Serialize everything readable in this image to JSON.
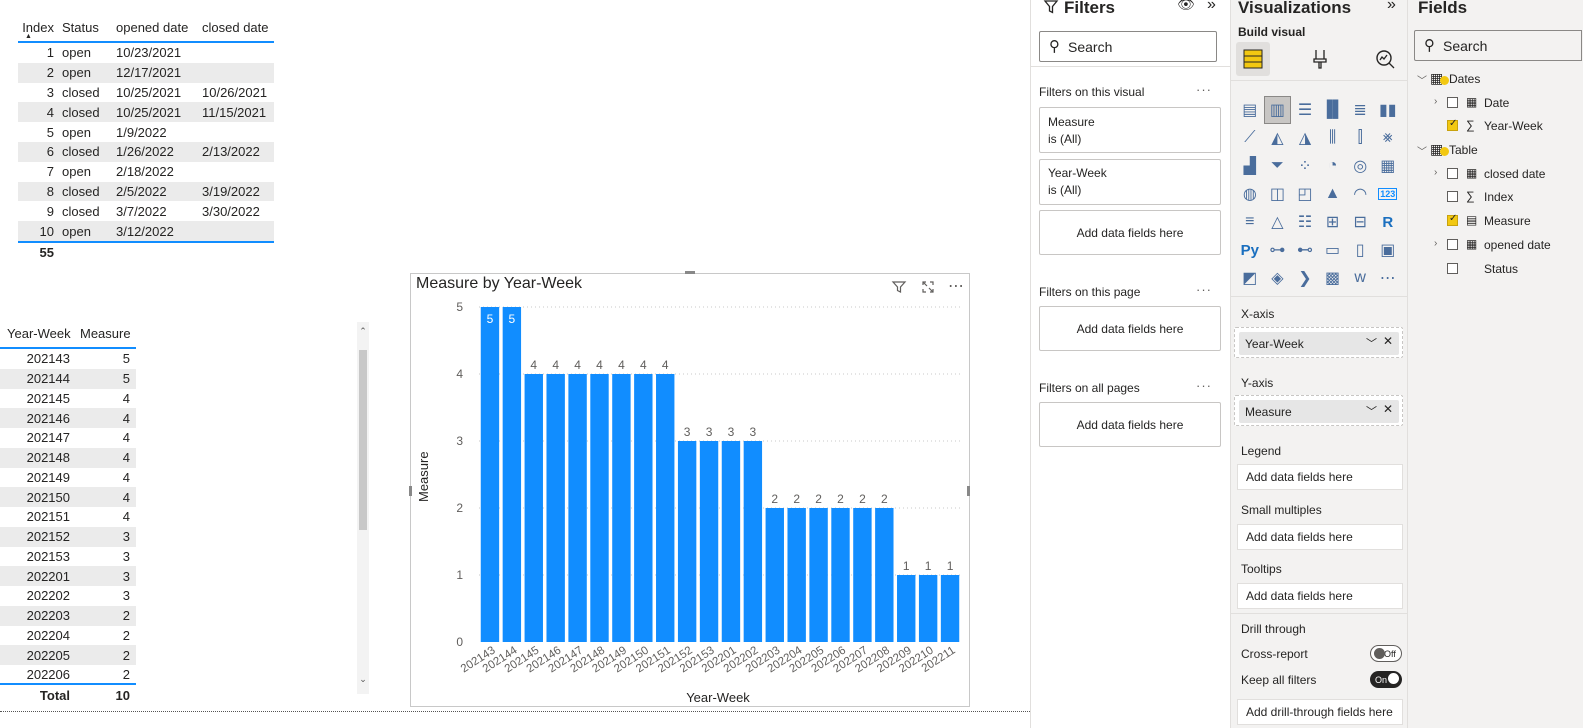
{
  "table1": {
    "headers": [
      "Index",
      "Status",
      "opened date",
      "closed date"
    ],
    "rows": [
      [
        "1",
        "open",
        "10/23/2021",
        ""
      ],
      [
        "2",
        "open",
        "12/17/2021",
        ""
      ],
      [
        "3",
        "closed",
        "10/25/2021",
        "10/26/2021"
      ],
      [
        "4",
        "closed",
        "10/25/2021",
        "11/15/2021"
      ],
      [
        "5",
        "open",
        "1/9/2022",
        ""
      ],
      [
        "6",
        "closed",
        "1/26/2022",
        "2/13/2022"
      ],
      [
        "7",
        "open",
        "2/18/2022",
        ""
      ],
      [
        "8",
        "closed",
        "2/5/2022",
        "3/19/2022"
      ],
      [
        "9",
        "closed",
        "3/7/2022",
        "3/30/2022"
      ],
      [
        "10",
        "open",
        "3/12/2022",
        ""
      ]
    ],
    "total": "55"
  },
  "table2": {
    "headers": [
      "Year-Week",
      "Measure"
    ],
    "rows": [
      [
        "202143",
        "5"
      ],
      [
        "202144",
        "5"
      ],
      [
        "202145",
        "4"
      ],
      [
        "202146",
        "4"
      ],
      [
        "202147",
        "4"
      ],
      [
        "202148",
        "4"
      ],
      [
        "202149",
        "4"
      ],
      [
        "202150",
        "4"
      ],
      [
        "202151",
        "4"
      ],
      [
        "202152",
        "3"
      ],
      [
        "202153",
        "3"
      ],
      [
        "202201",
        "3"
      ],
      [
        "202202",
        "3"
      ],
      [
        "202203",
        "2"
      ],
      [
        "202204",
        "2"
      ],
      [
        "202205",
        "2"
      ],
      [
        "202206",
        "2"
      ]
    ],
    "total_label": "Total",
    "total_value": "10"
  },
  "chart_data": {
    "type": "bar",
    "title": "Measure by Year-Week",
    "xlabel": "Year-Week",
    "ylabel": "Measure",
    "categories": [
      "202143",
      "202144",
      "202145",
      "202146",
      "202147",
      "202148",
      "202149",
      "202150",
      "202151",
      "202152",
      "202153",
      "202201",
      "202202",
      "202203",
      "202204",
      "202205",
      "202206",
      "202207",
      "202208",
      "202209",
      "202210",
      "202211"
    ],
    "values": [
      5,
      5,
      4,
      4,
      4,
      4,
      4,
      4,
      4,
      3,
      3,
      3,
      3,
      2,
      2,
      2,
      2,
      2,
      2,
      1,
      1,
      1
    ],
    "ylim": [
      0,
      5
    ],
    "yticks": [
      "0",
      "1",
      "2",
      "3",
      "4",
      "5"
    ],
    "grid": true,
    "data_labels": true,
    "bar_color": "#118dff"
  },
  "filters": {
    "title": "Filters",
    "search_placeholder": "Search",
    "on_visual_label": "Filters on this visual",
    "cards": [
      {
        "field": "Measure",
        "state": "is (All)"
      },
      {
        "field": "Year-Week",
        "state": "is (All)"
      }
    ],
    "add_fields": "Add data fields here",
    "on_page_label": "Filters on this page",
    "on_all_pages_label": "Filters on all pages"
  },
  "visualizations": {
    "title": "Visualizations",
    "build_visual": "Build visual",
    "x_axis_label": "X-axis",
    "x_axis_field": "Year-Week",
    "y_axis_label": "Y-axis",
    "y_axis_field": "Measure",
    "legend_label": "Legend",
    "small_multiples_label": "Small multiples",
    "tooltips_label": "Tooltips",
    "drill_through_label": "Drill through",
    "add_fields": "Add data fields here",
    "cross_report_label": "Cross-report",
    "cross_report_state": "Off",
    "keep_filters_label": "Keep all filters",
    "keep_filters_state": "On",
    "add_drill_fields": "Add drill-through fields here",
    "text_icons": {
      "py": "Py",
      "r": "R",
      "card": "123"
    }
  },
  "fields": {
    "title": "Fields",
    "search_placeholder": "Search",
    "tables": [
      {
        "name": "Dates",
        "items": [
          {
            "name": "Date",
            "checked": false,
            "expandable": true,
            "icon": "calendar-icon"
          },
          {
            "name": "Year-Week",
            "checked": true,
            "expandable": false,
            "icon": "sigma-icon"
          }
        ]
      },
      {
        "name": "Table",
        "items": [
          {
            "name": "closed date",
            "checked": false,
            "expandable": true,
            "icon": "calendar-icon"
          },
          {
            "name": "Index",
            "checked": false,
            "expandable": false,
            "icon": "sigma-icon"
          },
          {
            "name": "Measure",
            "checked": true,
            "expandable": false,
            "icon": "calculator-icon"
          },
          {
            "name": "opened date",
            "checked": false,
            "expandable": true,
            "icon": "calendar-icon"
          },
          {
            "name": "Status",
            "checked": false,
            "expandable": false,
            "icon": ""
          }
        ]
      }
    ]
  }
}
